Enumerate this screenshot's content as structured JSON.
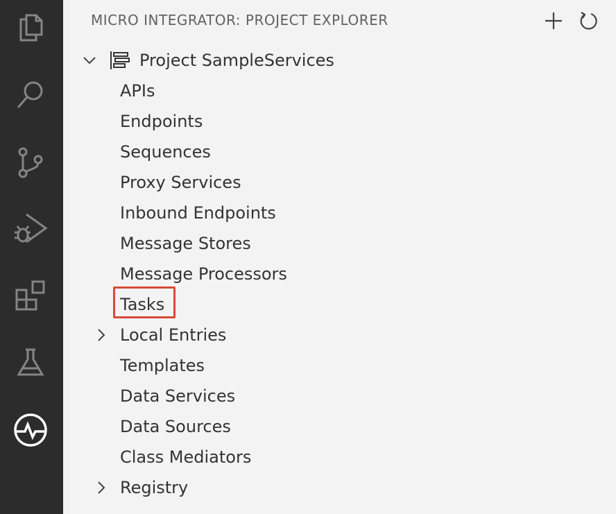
{
  "activity_bar": {
    "items": [
      {
        "icon": "files-icon"
      },
      {
        "icon": "search-icon"
      },
      {
        "icon": "source-control-icon"
      },
      {
        "icon": "run-debug-icon"
      },
      {
        "icon": "extensions-icon"
      },
      {
        "icon": "testing-icon"
      },
      {
        "icon": "micro-integrator-icon"
      }
    ]
  },
  "panel": {
    "title": "MICRO INTEGRATOR: PROJECT EXPLORER",
    "actions": [
      {
        "icon": "add-icon"
      },
      {
        "icon": "refresh-icon"
      }
    ]
  },
  "tree": {
    "project": {
      "label": "Project SampleServices",
      "expanded": true
    },
    "items": [
      {
        "label": "APIs",
        "expandable": false
      },
      {
        "label": "Endpoints",
        "expandable": false
      },
      {
        "label": "Sequences",
        "expandable": false
      },
      {
        "label": "Proxy Services",
        "expandable": false
      },
      {
        "label": "Inbound Endpoints",
        "expandable": false
      },
      {
        "label": "Message Stores",
        "expandable": false
      },
      {
        "label": "Message Processors",
        "expandable": false
      },
      {
        "label": "Tasks",
        "expandable": false,
        "highlighted": true
      },
      {
        "label": "Local Entries",
        "expandable": true
      },
      {
        "label": "Templates",
        "expandable": false
      },
      {
        "label": "Data Services",
        "expandable": false
      },
      {
        "label": "Data Sources",
        "expandable": false
      },
      {
        "label": "Class Mediators",
        "expandable": false
      },
      {
        "label": "Registry",
        "expandable": true
      }
    ]
  },
  "colors": {
    "activity_bar_bg": "#2c2c2c",
    "sidebar_bg": "#f3f3f3",
    "highlight": "#d84a36",
    "text": "#333333"
  }
}
